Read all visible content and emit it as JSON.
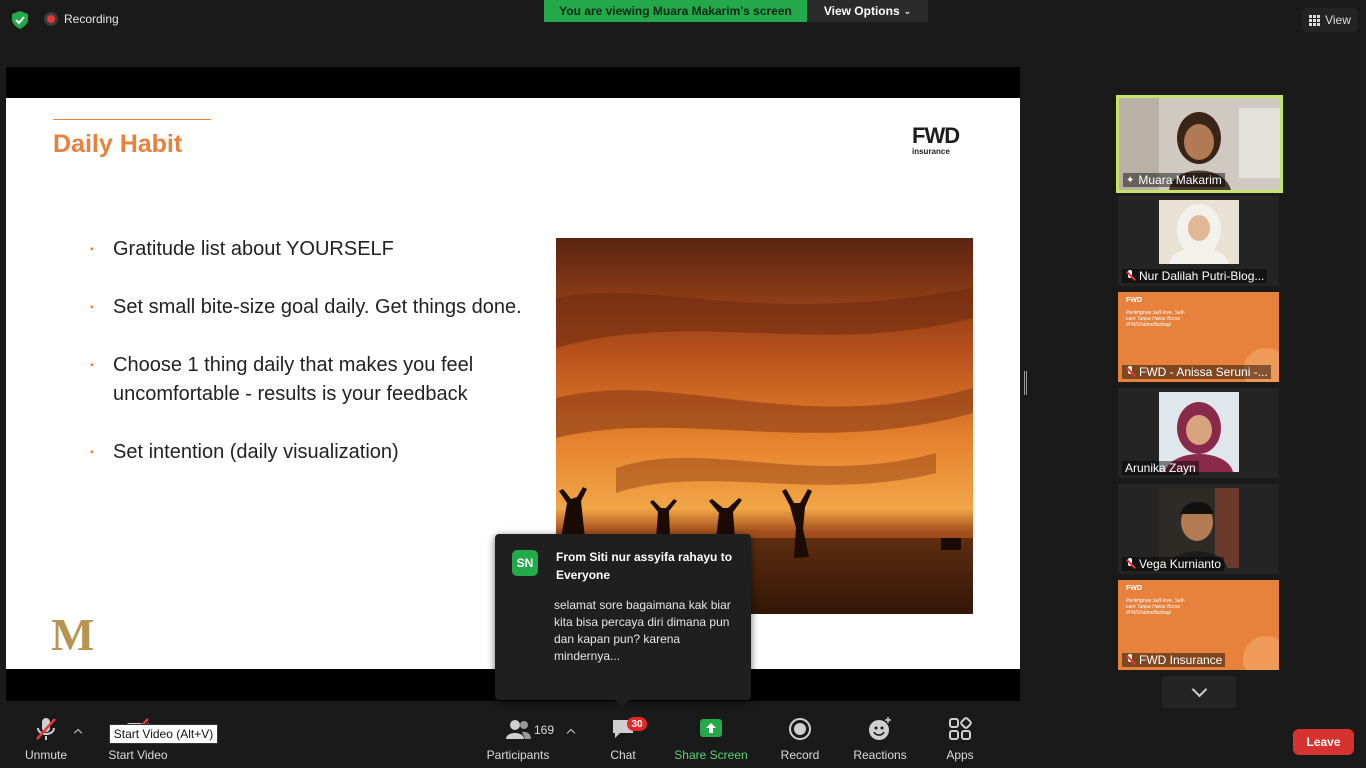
{
  "topbar": {
    "recording_label": "Recording",
    "viewing_banner": "You are viewing Muara Makarim's screen",
    "view_options_label": "View Options",
    "view_label": "View"
  },
  "slide": {
    "title": "Daily Habit",
    "logo_text": "FWD",
    "logo_subtext": "insurance",
    "bullets": [
      "Gratitude list about YOURSELF",
      "Set small bite-size goal daily. Get things done.",
      "Choose 1 thing daily that makes you  feel uncomfortable - results is your  feedback",
      "Set intention (daily visualization)"
    ],
    "footer_logo": "M"
  },
  "chat_popup": {
    "avatar_initials": "SN",
    "from": "From Siti nur assyifa rahayu to Everyone",
    "message": "selamat sore bagaimana kak biar kita bisa percaya diri dimana pun dan kapan pun? karena mindernya..."
  },
  "participants": [
    {
      "name": "Muara Makarim",
      "muted": false,
      "active": true
    },
    {
      "name": "Nur Dalilah Putri-Blog...",
      "muted": true
    },
    {
      "name": "FWD - Anissa Seruni -...",
      "muted": true,
      "card": true
    },
    {
      "name": "Arunika Zayn",
      "muted": false
    },
    {
      "name": "Vega Kurnianto",
      "muted": true
    },
    {
      "name": "FWD Insurance",
      "muted": true,
      "card": true
    }
  ],
  "card_text": {
    "brand": "FWD",
    "headline": "Pentingnya Self-love, Self-care Tanpa Harus Boros #FWDIstimeBerbagi"
  },
  "toolbar": {
    "unmute_label": "Unmute",
    "start_video_label": "Start Video",
    "start_video_tooltip": "Start Video (Alt+V)",
    "participants_label": "Participants",
    "participants_count": "169",
    "chat_label": "Chat",
    "chat_badge": "30",
    "share_screen_label": "Share Screen",
    "record_label": "Record",
    "reactions_label": "Reactions",
    "apps_label": "Apps",
    "leave_label": "Leave"
  },
  "colors": {
    "accent_green": "#23a84a",
    "slide_orange": "#e8813b",
    "leave_red": "#d6322f",
    "active_speaker": "#c6e36a"
  }
}
